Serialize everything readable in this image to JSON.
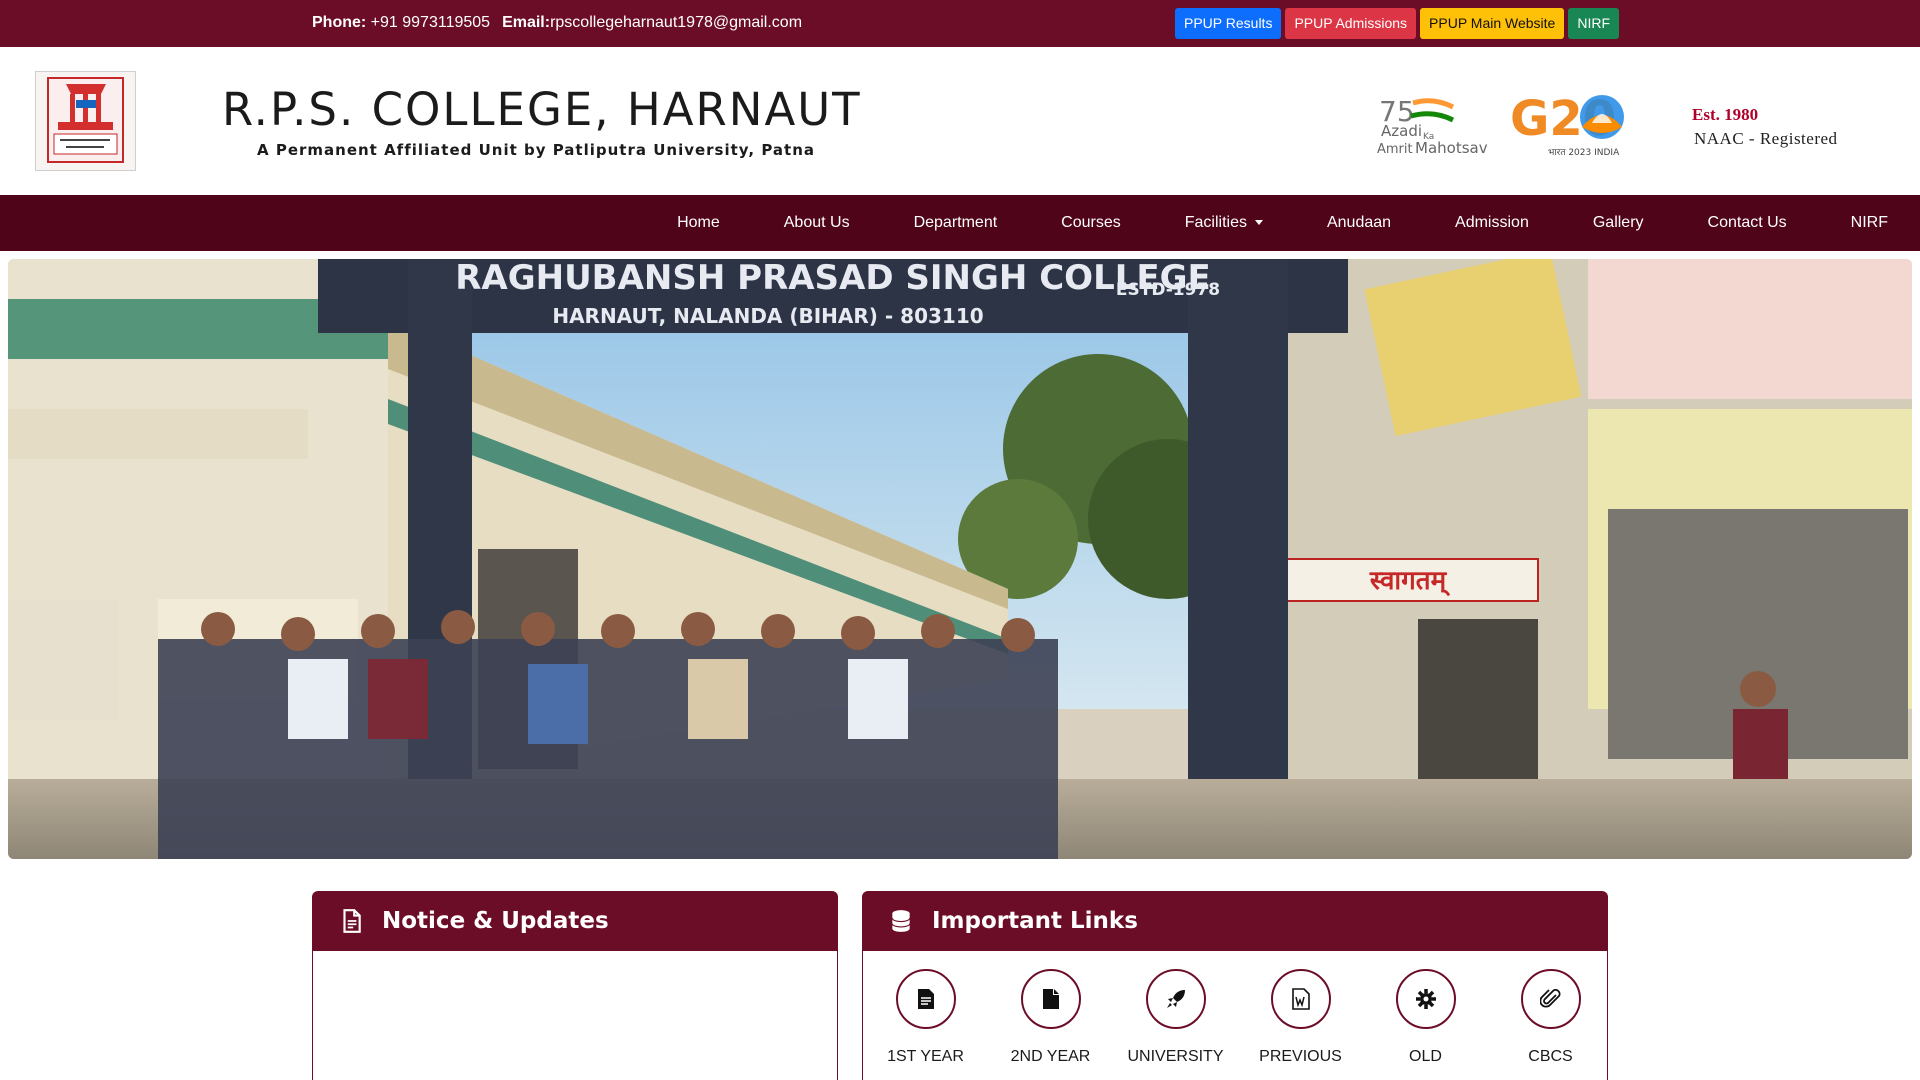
{
  "topbar": {
    "phone_label": "Phone:",
    "phone_value": "+91 9973119505",
    "email_label": "Email:",
    "email_value": "rpscollegeharnaut1978@gmail.com",
    "quick_links": [
      "PPUP Results",
      "PPUP Admissions",
      "PPUP Main Website",
      "NIRF"
    ]
  },
  "header": {
    "logo_icon": "college-crest",
    "college_name": "R.P.S. COLLEGE, HARNAUT",
    "subtitle": "A Permanent Affiliated Unit by Patliputra University, Patna",
    "aka_logo": {
      "number": "75",
      "line1": "Azadi",
      "ka": "Ka",
      "line2": "Amrit",
      "line3": "Mahotsav"
    },
    "g20_logo": {
      "text": "G20",
      "tag": "भारत 2023 INDIA"
    },
    "est": "Est. 1980",
    "naac": "NAAC - Registered"
  },
  "nav": {
    "items": [
      "Home",
      "About Us",
      "Department",
      "Courses",
      "Facilities",
      "Anudaan",
      "Admission",
      "Gallery",
      "Contact Us",
      "NIRF"
    ]
  },
  "hero": {
    "gate_title": "RAGHUBANSH PRASAD SINGH COLLEGE",
    "gate_address": "HARNAUT, NALANDA (BIHAR) - 803110",
    "gate_estd": "ESTD-1978",
    "welcome_sign": "स्वागतम्"
  },
  "notice": {
    "icon": "document-icon",
    "title": "Notice & Updates"
  },
  "important_links": {
    "icon": "database-icon",
    "title": "Important Links",
    "items": [
      {
        "icon": "file-text-icon",
        "label": "1ST YEAR"
      },
      {
        "icon": "file-icon",
        "label": "2ND YEAR"
      },
      {
        "icon": "rocket-icon",
        "label": "UNIVERSITY"
      },
      {
        "icon": "file-word-icon",
        "label": "PREVIOUS"
      },
      {
        "icon": "gear-icon",
        "label": "OLD"
      },
      {
        "icon": "paperclip-icon",
        "label": "CBCS"
      }
    ]
  },
  "colors": {
    "maroon": "#6b0d26",
    "nav_dark": "#4f0419",
    "btn_blue": "#0d6efd",
    "btn_red": "#dc3545",
    "btn_yellow": "#ffc107",
    "btn_green": "#198754",
    "est_red": "#b0002a"
  }
}
